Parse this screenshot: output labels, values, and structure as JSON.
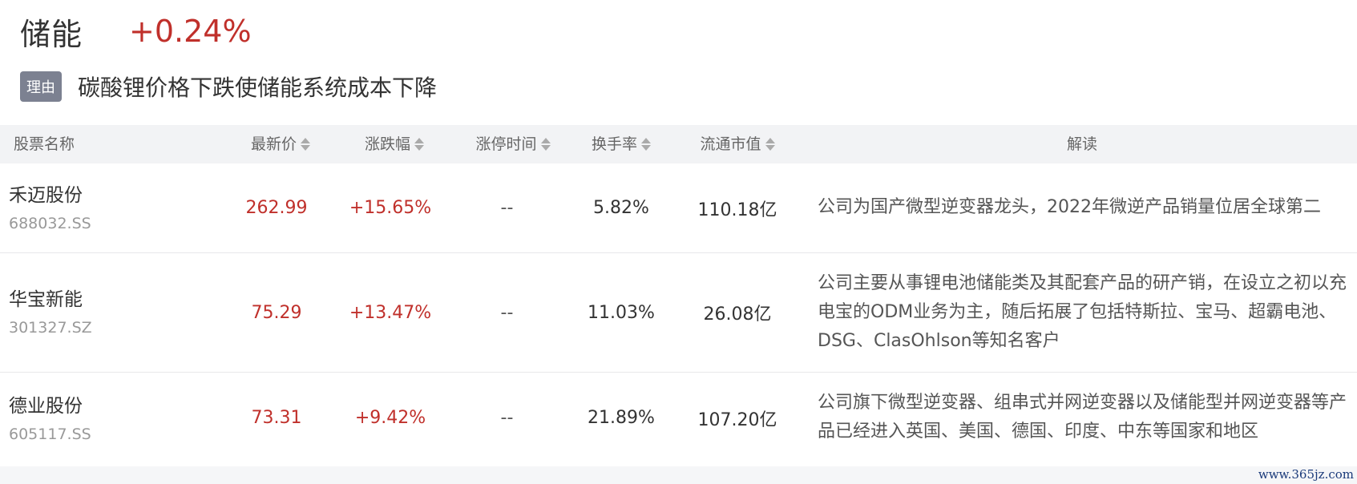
{
  "sector": {
    "name": "储能",
    "change": "+0.24%"
  },
  "reason": {
    "badge": "理由",
    "text": "碳酸锂价格下跌使储能系统成本下降"
  },
  "table": {
    "headers": {
      "name": "股票名称",
      "price": "最新价",
      "change": "涨跌幅",
      "limit_time": "涨停时间",
      "turnover": "换手率",
      "market_cap": "流通市值",
      "interpretation": "解读"
    },
    "rows": [
      {
        "name": "禾迈股份",
        "code": "688032.SS",
        "price": "262.99",
        "change": "+15.65%",
        "limit_time": "--",
        "turnover": "5.82%",
        "market_cap": "110.18亿",
        "interpretation": "公司为国产微型逆变器龙头，2022年微逆产品销量位居全球第二"
      },
      {
        "name": "华宝新能",
        "code": "301327.SZ",
        "price": "75.29",
        "change": "+13.47%",
        "limit_time": "--",
        "turnover": "11.03%",
        "market_cap": "26.08亿",
        "interpretation": "公司主要从事锂电池储能类及其配套产品的研产销，在设立之初以充电宝的ODM业务为主，随后拓展了包括特斯拉、宝马、超霸电池、DSG、ClasOhlson等知名客户"
      },
      {
        "name": "德业股份",
        "code": "605117.SS",
        "price": "73.31",
        "change": "+9.42%",
        "limit_time": "--",
        "turnover": "21.89%",
        "market_cap": "107.20亿",
        "interpretation": "公司旗下微型逆变器、组串式并网逆变器以及储能型并网逆变器等产品已经进入英国、美国、德国、印度、中东等国家和地区"
      }
    ]
  },
  "watermark": "www.365jz.com",
  "colors": {
    "up": "#c0302b",
    "badge": "#7c8191",
    "header_bg": "#f2f3f5"
  }
}
